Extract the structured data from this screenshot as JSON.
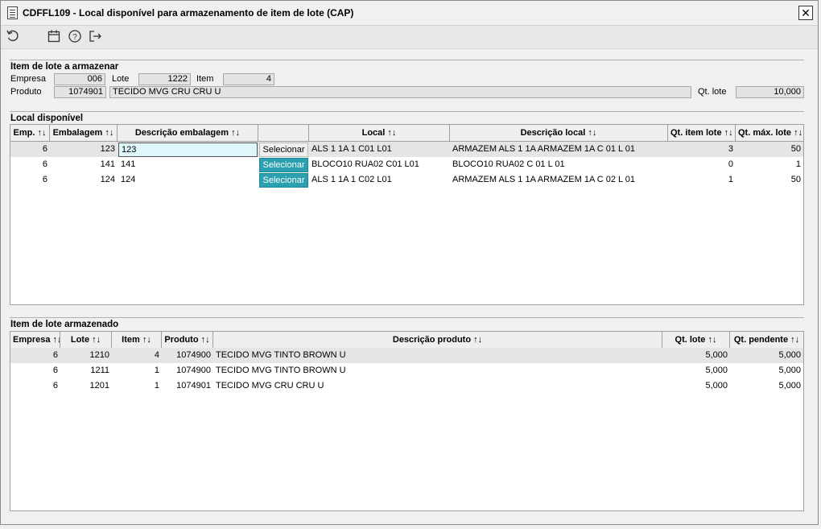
{
  "window": {
    "title": "CDFFL109 - Local disponível para armazenamento de item de lote (CAP)",
    "close_label": "✕"
  },
  "toolbar": {
    "icons": [
      "refresh-icon",
      "calendar-icon",
      "help-icon",
      "exit-icon"
    ]
  },
  "item_section": {
    "title": "Item de lote a armazenar",
    "empresa_label": "Empresa",
    "empresa_value": "006",
    "lote_label": "Lote",
    "lote_value": "1222",
    "item_label": "Item",
    "item_value": "4",
    "produto_label": "Produto",
    "produto_code": "1074901",
    "produto_desc": "TECIDO MVG CRU CRU U",
    "qtlote_label": "Qt. lote",
    "qtlote_value": "10,000"
  },
  "local_section": {
    "title": "Local disponível",
    "headers": [
      "Emp. ↑↓",
      "Embalagem ↑↓",
      "Descrição embalagem ↑↓",
      "",
      "Local ↑↓",
      "Descrição local ↑↓",
      "Qt. item lote ↑↓",
      "Qt. máx. lote ↑↓"
    ],
    "rows": [
      {
        "emp": "6",
        "embalagem": "123",
        "desc_embalagem": "123",
        "button": "Selecionar",
        "local": "ALS 1 1A 1 C01 L01",
        "desc_local": "ARMAZEM ALS 1 1A ARMAZEM 1A C 01 L 01",
        "qt_item": "3",
        "qt_max": "50"
      },
      {
        "emp": "6",
        "embalagem": "141",
        "desc_embalagem": "141",
        "button": "Selecionar",
        "local": "BLOCO10 RUA02 C01 L01",
        "desc_local": "BLOCO10 RUA02 C 01 L 01",
        "qt_item": "0",
        "qt_max": "1"
      },
      {
        "emp": "6",
        "embalagem": "124",
        "desc_embalagem": "124",
        "button": "Selecionar",
        "local": "ALS 1 1A 1 C02 L01",
        "desc_local": "ARMAZEM ALS 1 1A ARMAZEM 1A C 02 L 01",
        "qt_item": "1",
        "qt_max": "50"
      }
    ]
  },
  "stored_section": {
    "title": "Item de lote armazenado",
    "headers": [
      "Empresa ↑↓",
      "Lote ↑↓",
      "Item ↑↓",
      "Produto ↑↓",
      "Descrição produto ↑↓",
      "Qt. lote ↑↓",
      "Qt. pendente ↑↓"
    ],
    "rows": [
      {
        "empresa": "6",
        "lote": "1210",
        "item": "4",
        "produto": "1074900",
        "descricao": "TECIDO MVG TINTO BROWN U",
        "qt_lote": "5,000",
        "qt_pendente": "5,000"
      },
      {
        "empresa": "6",
        "lote": "1211",
        "item": "1",
        "produto": "1074900",
        "descricao": "TECIDO MVG TINTO BROWN U",
        "qt_lote": "5,000",
        "qt_pendente": "5,000"
      },
      {
        "empresa": "6",
        "lote": "1201",
        "item": "1",
        "produto": "1074901",
        "descricao": "TECIDO MVG CRU CRU U",
        "qt_lote": "5,000",
        "qt_pendente": "5,000"
      }
    ]
  },
  "colors": {
    "select_button": "#2aa0b0",
    "active_input": "#dff7fb",
    "selected_row": "#e5e5e5"
  }
}
